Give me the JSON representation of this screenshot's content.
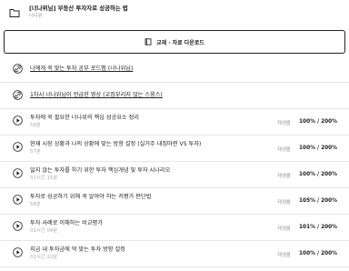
{
  "header": {
    "title": "[너나위님] 부동산 투자자로 성공하는 법",
    "instructor": "너나위"
  },
  "download": {
    "label": "교재 · 자료 다운로드"
  },
  "items": [
    {
      "type": "link",
      "title": "나에게 꼭 맞는 투자 공부 로드맵 (너나위님)"
    },
    {
      "type": "link",
      "title": "1차시 너나위님이 언급한 영상 (교집부리지 않는 스윙스)"
    },
    {
      "type": "video",
      "title": "투자에 꼭 필요한 너나위의 핵심 성공요소 정리",
      "duration": "59분",
      "status": "재생률",
      "progress": "100% / 200%"
    },
    {
      "type": "video",
      "title": "현재 시장 상황과 나의 상황에 맞는 방향 설정 (실거주 내집마련 VS 투자)",
      "duration": "57분",
      "status": "재생률",
      "progress": "100% / 200%"
    },
    {
      "type": "video",
      "title": "잃지 않는 투자를 하기 위한 투자 핵심개념 및 투자 시나리오",
      "duration": "01시간 15분",
      "status": "재생률",
      "progress": "100% / 200%"
    },
    {
      "type": "video",
      "title": "투자로 성공하기 위해 꼭 알아야 하는 저평가 판단법",
      "duration": "58분",
      "status": "재생률",
      "progress": "105% / 200%"
    },
    {
      "type": "video",
      "title": "투자 사례로 이해하는 비교평가",
      "duration": "01시간 04분",
      "status": "재생률",
      "progress": "101% / 200%"
    },
    {
      "type": "video",
      "title": "지금 내 투자금에 딱 맞는 투자 방향 설정",
      "duration": "01시간 22분",
      "status": "재생률",
      "progress": "100% / 200%"
    }
  ]
}
